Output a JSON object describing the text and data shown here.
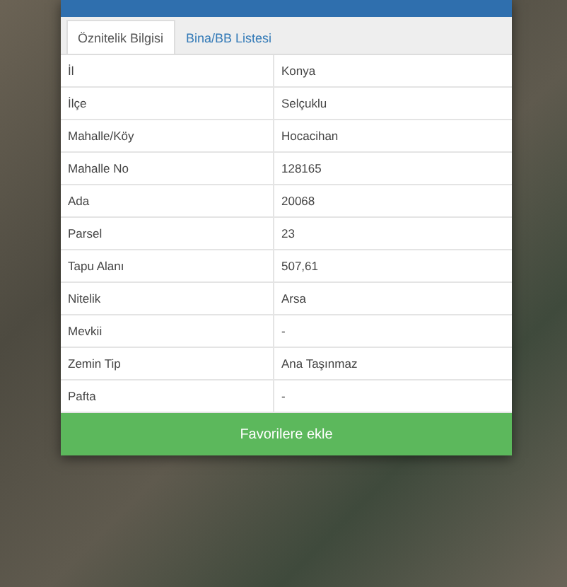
{
  "tabs": [
    {
      "label": "Öznitelik Bilgisi",
      "selected": true
    },
    {
      "label": "Bina/BB Listesi",
      "selected": false
    }
  ],
  "rows": [
    {
      "label": "İl",
      "value": "Konya"
    },
    {
      "label": "İlçe",
      "value": "Selçuklu"
    },
    {
      "label": "Mahalle/Köy",
      "value": "Hocacihan"
    },
    {
      "label": "Mahalle No",
      "value": "128165"
    },
    {
      "label": "Ada",
      "value": "20068"
    },
    {
      "label": "Parsel",
      "value": "23"
    },
    {
      "label": "Tapu Alanı",
      "value": "507,61"
    },
    {
      "label": "Nitelik",
      "value": "Arsa"
    },
    {
      "label": "Mevkii",
      "value": "-"
    },
    {
      "label": "Zemin Tip",
      "value": "Ana Taşınmaz"
    },
    {
      "label": "Pafta",
      "value": "-"
    }
  ],
  "button": "Favorilere ekle"
}
